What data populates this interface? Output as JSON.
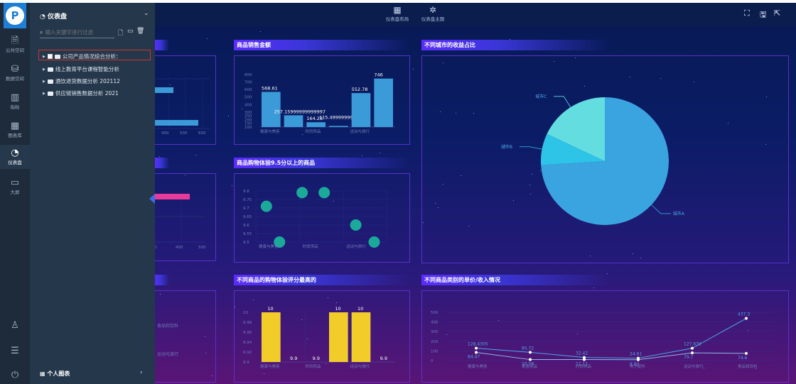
{
  "rail": {
    "items": [
      {
        "label": "公共空间",
        "icon": "document-icon"
      },
      {
        "label": "数据空间",
        "icon": "database-icon"
      },
      {
        "label": "指标",
        "icon": "bars-icon"
      },
      {
        "label": "图表库",
        "icon": "chart-library-icon"
      },
      {
        "label": "仪表盘",
        "icon": "gauge-icon"
      },
      {
        "label": "大屏",
        "icon": "monitor-icon"
      }
    ],
    "active": "仪表盘"
  },
  "panel": {
    "title": "仪表盘",
    "search_placeholder": "输入关键字进行过滤",
    "tree": [
      "公司产品情况综合分析：",
      "线上教育平台课程智能分析",
      "酒饮退货数据分析 202112",
      "供应链销售数据分析 2021"
    ],
    "footer": "个人图表"
  },
  "toolbar": {
    "layout_label": "仪表盘布局",
    "theme_label": "仪表盘主题"
  },
  "panels": {
    "sales_title": "商品销售金额",
    "city_title": "不同城市的收益占比",
    "rating_title": "商品购物体验9.5分以上的商品",
    "top_rating_title": "不同商品的购物体验评分最高的",
    "price_title": "不同商品类别的单价/收入情况"
  },
  "colors": {
    "bar_blue": "#3b9ad8",
    "bar_yellow": "#f2cd2a",
    "scatter": "#1ba99a",
    "pie_a": "#3aa4e0",
    "pie_b": "#2ec4e8",
    "pie_c": "#63dde0",
    "pink_bar": "#e83a9a"
  },
  "chart_data": [
    {
      "type": "bar",
      "title": "商品销售金额",
      "categories": [
        "健康与美容",
        "",
        "时尚饰品",
        "",
        "运动与旅行",
        ""
      ],
      "values": [
        568.61,
        257.15999999999997,
        164.28,
        115.49999999999999,
        552.78,
        746
      ],
      "data_labels": [
        "568.61",
        "257.15999999999997",
        "164.28",
        "115.49999999999999",
        "552.78",
        "746"
      ],
      "y_ticks": [
        "100",
        "150",
        "200",
        "250",
        "300",
        "400",
        "500",
        "600",
        "700",
        "800"
      ],
      "ylim": [
        100,
        800
      ]
    },
    {
      "type": "pie",
      "title": "不同城市的收益占比",
      "labels": [
        "城市A",
        "城市B",
        "城市C"
      ],
      "values": [
        74,
        8,
        18
      ]
    },
    {
      "type": "scatter",
      "title": "商品购物体验9.5分以上的商品",
      "x_ticks": [
        "健康与美容",
        "时尚饰品",
        "运动与旅行"
      ],
      "y_ticks": [
        "9.5",
        "9.55",
        "9.6",
        "9.65",
        "9.7",
        "9.75",
        "9.8"
      ],
      "points": [
        {
          "x": 0.2,
          "y": 9.71
        },
        {
          "x": 0.45,
          "y": 9.5
        },
        {
          "x": 0.88,
          "y": 9.79
        },
        {
          "x": 1.3,
          "y": 9.79
        },
        {
          "x": 1.9,
          "y": 9.6
        },
        {
          "x": 2.25,
          "y": 9.5
        }
      ],
      "ylim": [
        9.5,
        9.8
      ]
    },
    {
      "type": "bar",
      "title": "不同商品的购物体验评分最高的",
      "categories": [
        "健康与美容",
        "",
        "时尚饰品",
        "",
        "运动与旅行",
        ""
      ],
      "values": [
        10,
        9.9,
        9.9,
        10,
        10,
        9.9
      ],
      "data_labels": [
        "10",
        "9.9",
        "9.9",
        "10",
        "10",
        "9.9"
      ],
      "y_ticks": [
        "9.9",
        "9.92",
        "9.94",
        "9.96",
        "9.98",
        "10"
      ],
      "ylim": [
        9.9,
        10
      ]
    },
    {
      "type": "line",
      "title": "不同商品类别的单价/收入情况",
      "categories": [
        "健康与美容",
        "家居用品",
        "时尚饰品",
        "电子配件",
        "运动与旅行",
        "食品和饮料"
      ],
      "y_ticks": [
        "0",
        "100",
        "200",
        "300",
        "400",
        "500"
      ],
      "ylim": [
        0,
        500
      ],
      "series": [
        {
          "values": [
            128.4305,
            85.72,
            32.42,
            24.61,
            127.639,
            437.3
          ],
          "labels": [
            "128.4305",
            "85.72",
            "32.42",
            "24.61",
            "127.639",
            "437.3"
          ]
        },
        {
          "values": [
            84.47,
            10.58,
            11.11,
            8.93,
            79.7,
            74.6
          ],
          "labels": [
            "84.47",
            "10.58",
            "11.11",
            "8.93",
            "79.7",
            "74.6"
          ]
        }
      ]
    }
  ],
  "partial": {
    "hbar_ticks": [
      "400",
      "500",
      "600"
    ],
    "hbar2_ticks": [
      "0",
      "400",
      "500"
    ],
    "row_labels": [
      "食品和饮料",
      "运动与旅行"
    ]
  }
}
